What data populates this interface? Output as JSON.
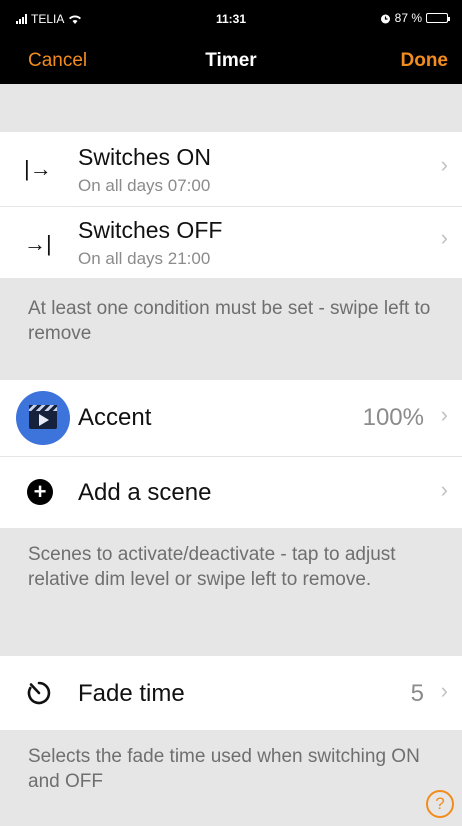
{
  "status_bar": {
    "carrier": "TELIA",
    "time": "11:31",
    "battery": "87 %",
    "battery_level": 0.87
  },
  "nav": {
    "cancel": "Cancel",
    "title": "Timer",
    "done": "Done"
  },
  "switches": [
    {
      "title": "Switches ON",
      "subtitle": "On all days  07:00",
      "icon": "switch-on-icon",
      "glyph": "|→"
    },
    {
      "title": "Switches OFF",
      "subtitle": "On all days  21:00",
      "icon": "switch-off-icon",
      "glyph": "→|"
    }
  ],
  "conditions_note": "At least one condition must be set - swipe left to remove",
  "scenes": {
    "items": [
      {
        "label": "Accent",
        "value": "100%",
        "icon": "scene-clapperboard-icon"
      }
    ],
    "add_label": "Add a scene",
    "note": "Scenes to activate/deactivate - tap to adjust relative dim level or swipe left to remove."
  },
  "fade": {
    "label": "Fade time",
    "value": "5",
    "icon": "timer-icon",
    "note": "Selects the fade time used when switching ON and OFF"
  },
  "chevron": "›",
  "help": "?",
  "colors": {
    "accent": "#f28c1e",
    "scene_icon_bg": "#3d74dc",
    "background": "#e6e6e6"
  }
}
